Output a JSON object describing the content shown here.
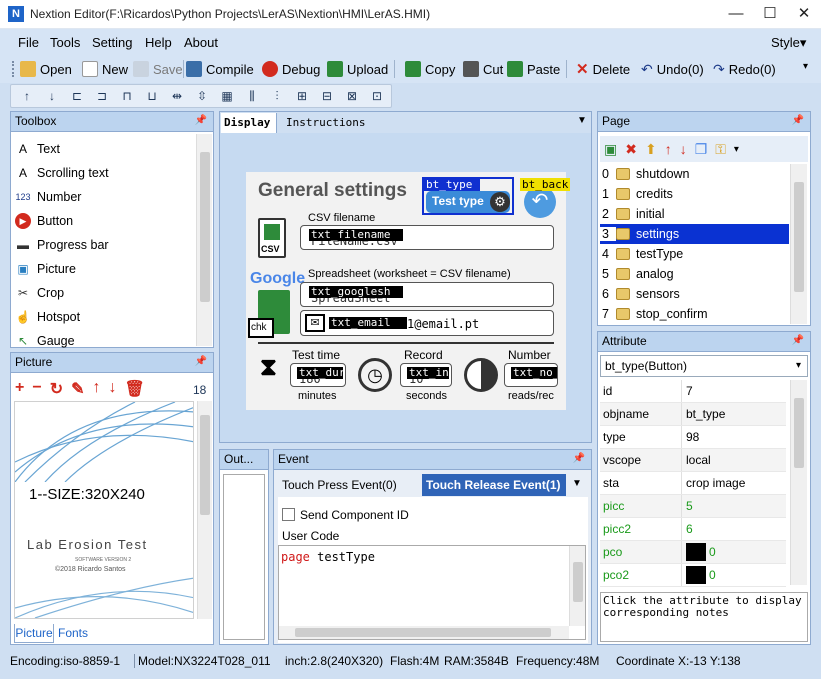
{
  "window": {
    "title": "Nextion Editor(F:\\Ricardos\\Python Projects\\LerAS\\Nextion\\HMI\\LerAS.HMI)",
    "minimize": "—",
    "maximize": "☐",
    "close": "✕"
  },
  "menu": {
    "items": [
      "File",
      "Tools",
      "Setting",
      "Help",
      "About"
    ],
    "style": "Style▾"
  },
  "toolbar": {
    "open": "Open",
    "new": "New",
    "save": "Save",
    "compile": "Compile",
    "debug": "Debug",
    "upload": "Upload",
    "copy": "Copy",
    "cut": "Cut",
    "paste": "Paste",
    "delete": "Delete",
    "undo": "Undo(0)",
    "redo": "Redo(0)"
  },
  "align_toolbar": {
    "icons": [
      "↑",
      "↓",
      "⊏",
      "⊐",
      "⊓",
      "⊔",
      "⇹",
      "⇳",
      "▦",
      "⫼",
      "⫶",
      "⊞",
      "⊟",
      "⊠",
      "⊡"
    ]
  },
  "toolbox": {
    "title": "Toolbox",
    "items": [
      {
        "label": "Text",
        "icon": "A"
      },
      {
        "label": "Scrolling text",
        "icon": "A"
      },
      {
        "label": "Number",
        "icon": "123"
      },
      {
        "label": "Button",
        "icon": "▶"
      },
      {
        "label": "Progress bar",
        "icon": "▬"
      },
      {
        "label": "Picture",
        "icon": "▣"
      },
      {
        "label": "Crop",
        "icon": "✂"
      },
      {
        "label": "Hotspot",
        "icon": "☝"
      },
      {
        "label": "Gauge",
        "icon": "↖"
      }
    ]
  },
  "picture_panel": {
    "title": "Picture",
    "count": "18",
    "preview_text": "1--SIZE:320X240",
    "preview_title": "Lab Erosion Test",
    "preview_version": "SOFTWARE VERSION 2",
    "preview_copyright": "©2018 Ricardo Santos",
    "tabs": [
      "Picture",
      "Fonts"
    ]
  },
  "display": {
    "tabs": [
      "Display",
      "Instructions"
    ],
    "dropdown": "▼"
  },
  "screen": {
    "heading": "General settings",
    "bt_type": "bt_type",
    "bt_type_label": "Test type",
    "bt_back": "bt_back",
    "csv_label": "CSV filename",
    "csv_icon": "CSV",
    "txt_filename": "txt_filename",
    "filename_ghost": "FileName.csv",
    "google_label": "Google",
    "spreadsheet_label": "Spreadsheet (worksheet = CSV filename)",
    "txt_googlesh": "txt_googlesh",
    "googlesh_ghost": "SpreadSheet",
    "chk": "chk",
    "txt_email": "txt_email",
    "email_suffix": "1@email.pt",
    "test_time_label": "Test time",
    "txt_durat": "txt_durat",
    "durat_ghost": "180",
    "minutes": "minutes",
    "record_label": "Record",
    "txt_inter": "txt_inter",
    "inter_ghost": "10",
    "seconds": "seconds",
    "number_label": "Number",
    "txt_no_re": "txt_no_re",
    "reads_label": "reads/rec"
  },
  "output": {
    "title": "Out..."
  },
  "event": {
    "title": "Event",
    "tab_press": "Touch Press Event(0)",
    "tab_release": "Touch Release Event(1)",
    "send_component_id": "Send Component ID",
    "user_code_label": "User Code",
    "code_keyword": "page",
    "code_arg": " testType"
  },
  "page_panel": {
    "title": "Page",
    "pages": [
      {
        "num": "0",
        "name": "shutdown"
      },
      {
        "num": "1",
        "name": "credits"
      },
      {
        "num": "2",
        "name": "initial"
      },
      {
        "num": "3",
        "name": "settings"
      },
      {
        "num": "4",
        "name": "testType"
      },
      {
        "num": "5",
        "name": "analog"
      },
      {
        "num": "6",
        "name": "sensors"
      },
      {
        "num": "7",
        "name": "stop_confirm"
      }
    ]
  },
  "attribute_panel": {
    "title": "Attribute",
    "selected": "bt_type(Button)",
    "rows": [
      {
        "key": "id",
        "value": "7",
        "green": false,
        "swatch": false
      },
      {
        "key": "objname",
        "value": "bt_type",
        "green": false,
        "swatch": false
      },
      {
        "key": "type",
        "value": "98",
        "green": false,
        "swatch": false
      },
      {
        "key": "vscope",
        "value": "local",
        "green": false,
        "swatch": false
      },
      {
        "key": "sta",
        "value": "crop image",
        "green": false,
        "swatch": false
      },
      {
        "key": "picc",
        "value": "5",
        "green": true,
        "swatch": false
      },
      {
        "key": "picc2",
        "value": "6",
        "green": true,
        "swatch": false
      },
      {
        "key": "pco",
        "value": "0",
        "green": true,
        "swatch": true
      },
      {
        "key": "pco2",
        "value": "0",
        "green": true,
        "swatch": true
      }
    ],
    "note": "Click the attribute to display corresponding notes"
  },
  "statusbar": {
    "encoding": "Encoding:iso-8859-1",
    "model": "Model:NX3224T028_011",
    "inch": "inch:2.8(240X320)",
    "flash": "Flash:4M",
    "ram": "RAM:3584B",
    "frequency": "Frequency:48M",
    "coordinate": "Coordinate X:-13  Y:138"
  },
  "colors": {
    "accent": "#1e64c8",
    "selection": "#0a32d2",
    "panel_header": "#bcd4ef",
    "background": "#cfdff2",
    "delete_red": "#d22a1e"
  }
}
